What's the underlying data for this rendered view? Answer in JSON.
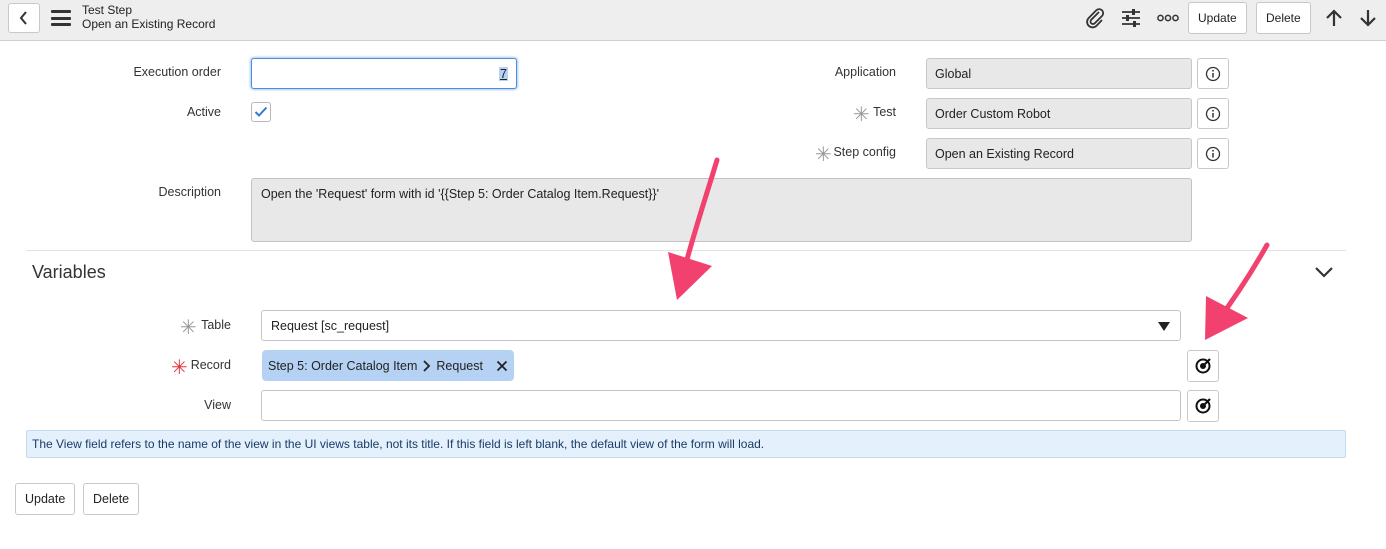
{
  "header": {
    "title": "Test Step",
    "subtitle": "Open an Existing Record",
    "update_label": "Update",
    "delete_label": "Delete"
  },
  "form": {
    "execution_order": {
      "label": "Execution order",
      "value": "7"
    },
    "active": {
      "label": "Active",
      "checked": true
    },
    "description": {
      "label": "Description",
      "value": "Open the 'Request' form with id '{{Step 5: Order Catalog Item.Request}}'"
    },
    "application": {
      "label": "Application",
      "value": "Global"
    },
    "test": {
      "label": "Test",
      "value": "Order Custom Robot"
    },
    "step_config": {
      "label": "Step config",
      "value": "Open an Existing Record"
    }
  },
  "variables": {
    "section_title": "Variables",
    "table": {
      "label": "Table",
      "value": "Request [sc_request]"
    },
    "record": {
      "label": "Record",
      "chip_step": "Step 5: Order Catalog Item",
      "chip_field": "Request"
    },
    "view": {
      "label": "View",
      "value": ""
    },
    "notice": "The View field refers to the name of the view in the UI views table, not its title. If this field is left blank, the default view of the form will load."
  },
  "footer": {
    "update_label": "Update",
    "delete_label": "Delete"
  },
  "colors": {
    "annotation_arrow": "#f2416f",
    "required_star": "#e3343f",
    "chip_bg": "#b5d2f4",
    "notice_bg": "#e4f0fb"
  }
}
